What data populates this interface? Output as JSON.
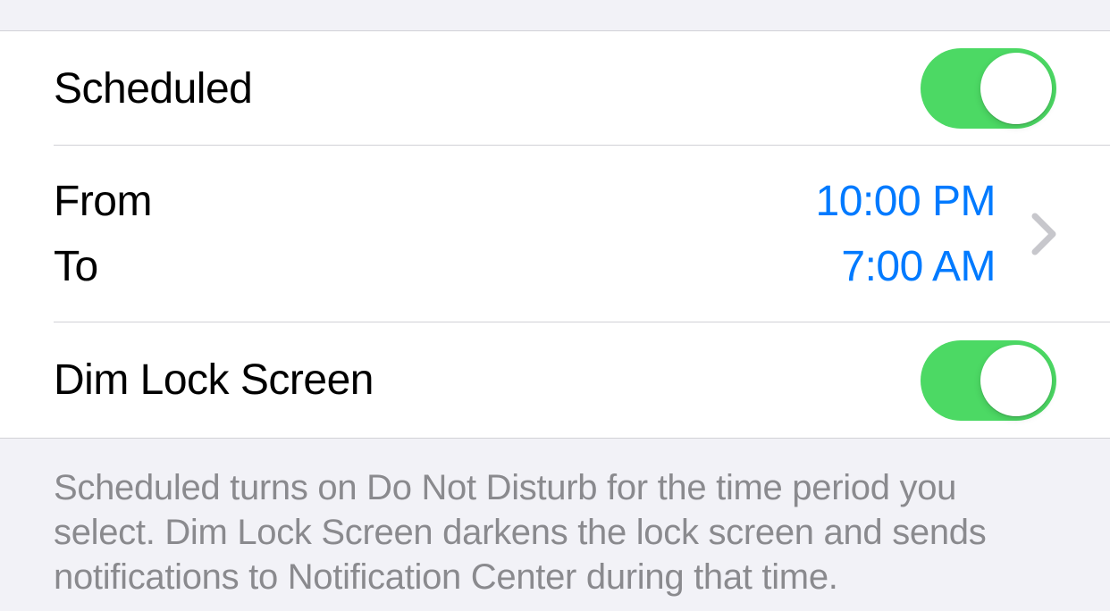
{
  "rows": {
    "scheduled": {
      "label": "Scheduled",
      "toggle_on": true
    },
    "schedule_range": {
      "from_label": "From",
      "to_label": "To",
      "from_value": "10:00 PM",
      "to_value": "7:00 AM"
    },
    "dim_lock_screen": {
      "label": "Dim Lock Screen",
      "toggle_on": true
    }
  },
  "footer": "Scheduled turns on Do Not Disturb for the time period you select. Dim Lock Screen darkens the lock screen and sends notifications to Notification Center during that time.",
  "colors": {
    "toggle_on": "#4cd964",
    "link": "#007aff",
    "footer_text": "#8a8a8e"
  }
}
